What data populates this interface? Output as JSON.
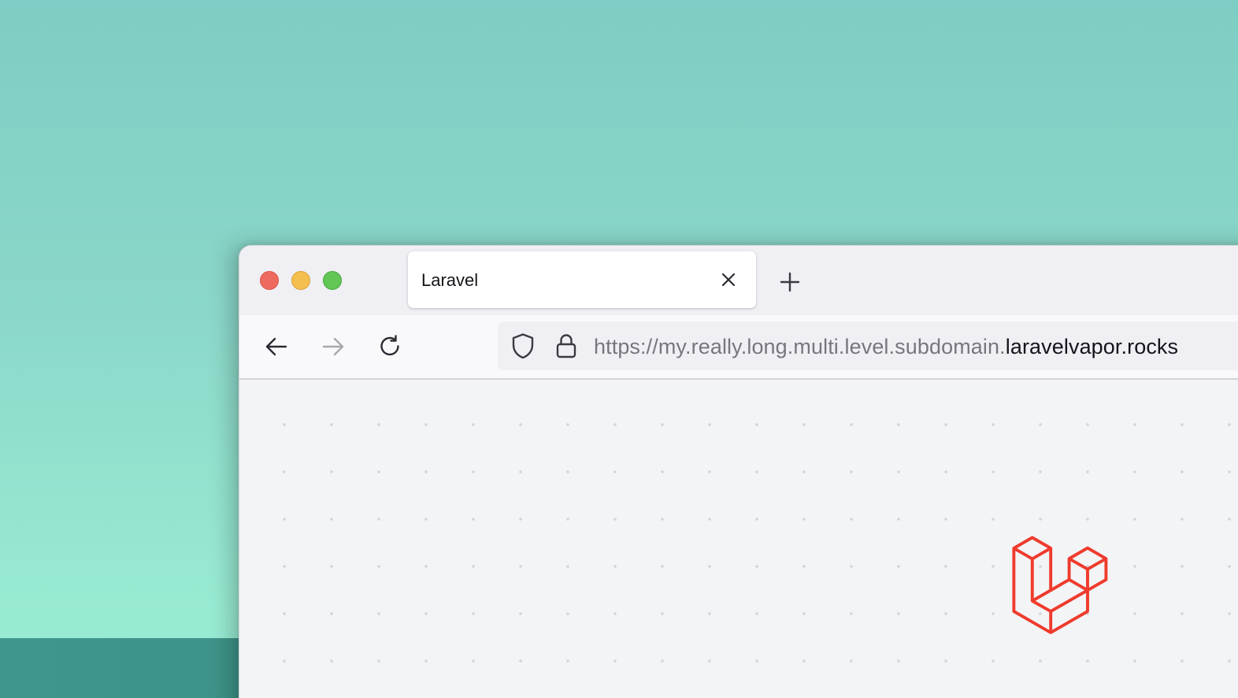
{
  "window": {
    "title": "Laravel"
  },
  "tabs": [
    {
      "label": "Laravel",
      "active": true
    }
  ],
  "toolbar": {
    "back_icon": "arrow-left-icon",
    "forward_icon": "arrow-right-icon",
    "forward_enabled": false,
    "reload_icon": "reload-icon",
    "new_tab_icon": "plus-icon"
  },
  "urlbar": {
    "url_prefix": "https://my.really.long.multi.level.subdomain.",
    "url_domain": "laravelvapor.rocks",
    "shield_icon": "shield-icon",
    "lock_icon": "lock-icon"
  },
  "page": {
    "logo_icon": "laravel-logo-icon",
    "logo_color": "#ef3b2d"
  },
  "colors": {
    "traffic_close": "#ee6a5f",
    "traffic_minimize": "#f5bf4f",
    "traffic_maximize": "#62c655",
    "desktop_top": "#7ecdc4",
    "desktop_bottom": "#98ebd3"
  }
}
